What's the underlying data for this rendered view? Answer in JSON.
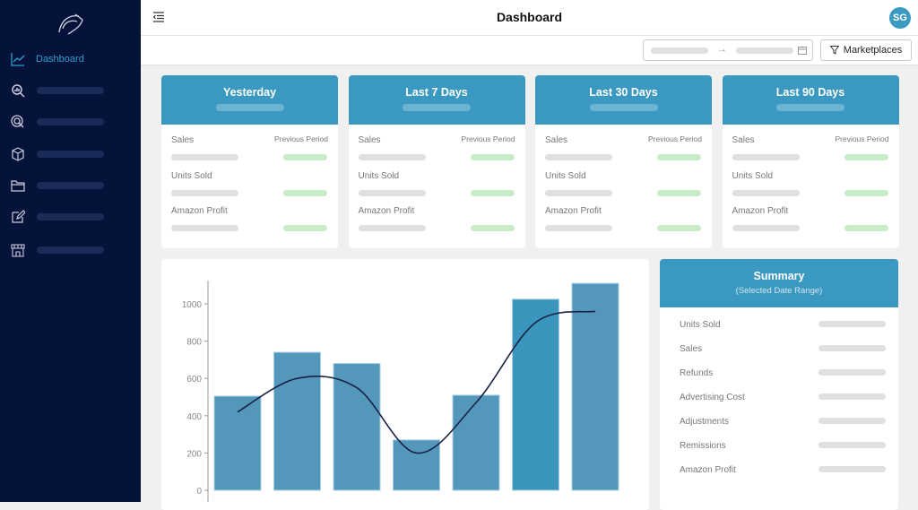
{
  "header": {
    "title": "Dashboard",
    "avatar": "SG"
  },
  "sidebar": {
    "items": [
      {
        "label": "Dashboard",
        "icon": "chart-line-icon",
        "active": true
      },
      {
        "icon": "search-chart-icon"
      },
      {
        "icon": "target-icon"
      },
      {
        "icon": "box-icon"
      },
      {
        "icon": "folder-icon"
      },
      {
        "icon": "edit-icon"
      },
      {
        "icon": "store-icon"
      }
    ]
  },
  "toolbar": {
    "date_separator": "→",
    "marketplaces_label": "Marketplaces"
  },
  "cards": [
    {
      "title": "Yesterday",
      "rows": [
        "Sales",
        "Units Sold",
        "Amazon Profit"
      ],
      "previous": "Previous Period"
    },
    {
      "title": "Last 7 Days",
      "rows": [
        "Sales",
        "Units Sold",
        "Amazon Profit"
      ],
      "previous": "Previous Period"
    },
    {
      "title": "Last 30 Days",
      "rows": [
        "Sales",
        "Units Sold",
        "Amazon Profit"
      ],
      "previous": "Previous Period"
    },
    {
      "title": "Last 90 Days",
      "rows": [
        "Sales",
        "Units Sold",
        "Amazon Profit"
      ],
      "previous": "Previous Period"
    }
  ],
  "summary": {
    "title": "Summary",
    "subtitle": "(Selected Date Range)",
    "rows": [
      "Units Sold",
      "Sales",
      "Refunds",
      "Advertising Cost",
      "Adjustments",
      "Remissions",
      "Amazon Profit"
    ]
  },
  "colors": {
    "sidebar": "#05133a",
    "accent": "#3b98c0",
    "bar": "#5398ba",
    "line": "#1a2145"
  },
  "chart_data": {
    "type": "bar",
    "yticks": [
      0,
      200,
      400,
      600,
      800,
      1000
    ],
    "ylim": [
      0,
      1120
    ],
    "bars": [
      505,
      740,
      680,
      270,
      510,
      1025,
      1110
    ],
    "line": [
      420,
      600,
      550,
      200,
      470,
      900,
      960
    ]
  }
}
